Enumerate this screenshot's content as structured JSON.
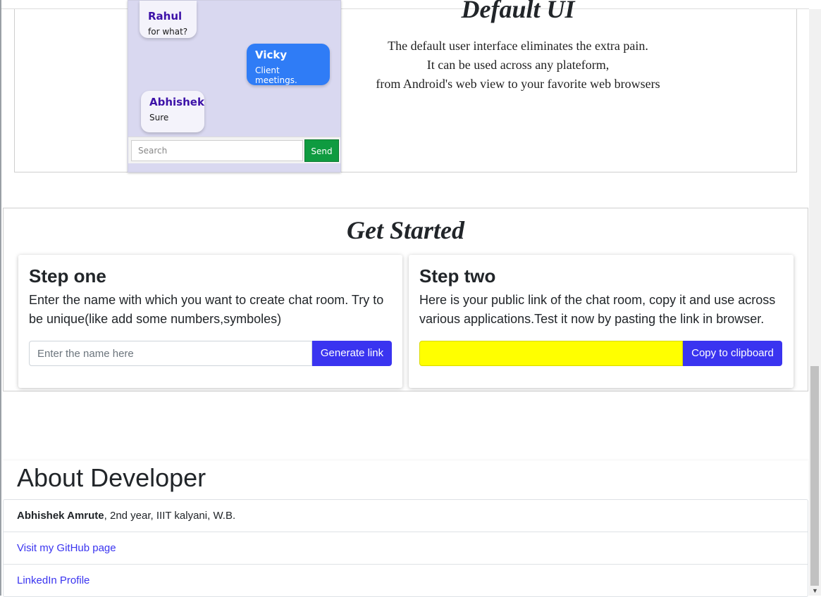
{
  "default_ui": {
    "title": "Default UI",
    "lines": [
      "The default user interface eliminates the extra pain.",
      "It can be used across any plateform,",
      "from Android's web view to your favorite web browsers"
    ],
    "chat": {
      "messages": [
        {
          "sender": "Rahul",
          "text": "for what?"
        },
        {
          "sender": "Vicky",
          "text": "Client meetings."
        },
        {
          "sender": "Abhishek",
          "text": "Sure"
        }
      ],
      "search_placeholder": "Search",
      "send_label": "Send"
    }
  },
  "get_started": {
    "title": "Get Started",
    "step_one": {
      "heading": "Step one",
      "text": "Enter the name with which you want to create chat room. Try to be unique(like add some numbers,symboles)",
      "input_placeholder": "Enter the name here",
      "button": "Generate link"
    },
    "step_two": {
      "heading": "Step two",
      "text": "Here is your public link of the chat room, copy it and use across various applications.Test it now by pasting the link in browser.",
      "link_value": "",
      "button": "Copy to clipboard"
    }
  },
  "about": {
    "title": "About Developer",
    "name": "Abhishek Amrute",
    "details": ", 2nd year, IIIT kalyani, W.B.",
    "github_link": "Visit my GitHub page",
    "linkedin_link": "LinkedIn Profile"
  },
  "colors": {
    "primary": "#3a34f0",
    "send_button": "#0f9b40",
    "link_field": "#ffff00",
    "bubble_blue": "#2f7cf6"
  }
}
